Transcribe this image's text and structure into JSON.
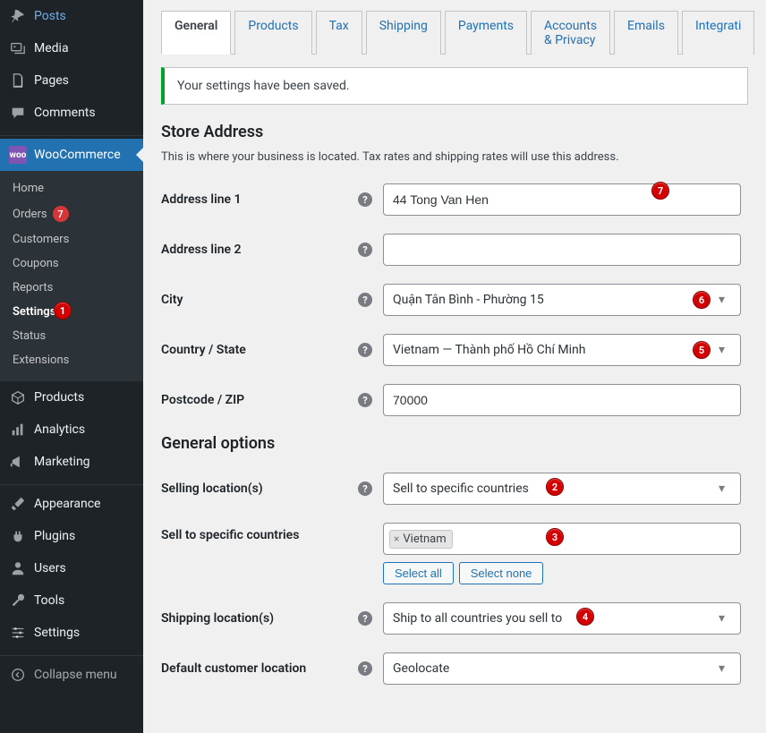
{
  "sidebar": {
    "items_top": [
      {
        "label": "Posts"
      },
      {
        "label": "Media"
      },
      {
        "label": "Pages"
      },
      {
        "label": "Comments"
      }
    ],
    "woo": {
      "label": "WooCommerce"
    },
    "submenu": [
      {
        "label": "Home"
      },
      {
        "label": "Orders",
        "badge": "7"
      },
      {
        "label": "Customers"
      },
      {
        "label": "Coupons"
      },
      {
        "label": "Reports"
      },
      {
        "label": "Settings"
      },
      {
        "label": "Status"
      },
      {
        "label": "Extensions"
      }
    ],
    "items_mid": [
      {
        "label": "Products"
      },
      {
        "label": "Analytics"
      },
      {
        "label": "Marketing"
      }
    ],
    "items_bot": [
      {
        "label": "Appearance"
      },
      {
        "label": "Plugins"
      },
      {
        "label": "Users"
      },
      {
        "label": "Tools"
      },
      {
        "label": "Settings"
      }
    ],
    "collapse": "Collapse menu"
  },
  "tabs": [
    {
      "label": "General"
    },
    {
      "label": "Products"
    },
    {
      "label": "Tax"
    },
    {
      "label": "Shipping"
    },
    {
      "label": "Payments"
    },
    {
      "label": "Accounts & Privacy"
    },
    {
      "label": "Emails"
    },
    {
      "label": "Integrati"
    }
  ],
  "notice": "Your settings have been saved.",
  "section1": {
    "title": "Store Address",
    "desc": "This is where your business is located. Tax rates and shipping rates will use this address.",
    "addr1_label": "Address line 1",
    "addr1_value": "44 Tong Van Hen",
    "addr2_label": "Address line 2",
    "addr2_value": "",
    "city_label": "City",
    "city_value": "Quận Tân Bình - Phường 15",
    "country_label": "Country / State",
    "country_value": "Vietnam — Thành phố Hồ Chí Minh",
    "postcode_label": "Postcode / ZIP",
    "postcode_value": "70000"
  },
  "section2": {
    "title": "General options",
    "selling_label": "Selling location(s)",
    "selling_value": "Sell to specific countries",
    "sellto_label": "Sell to specific countries",
    "sellto_token": "Vietnam",
    "select_all": "Select all",
    "select_none": "Select none",
    "shipping_label": "Shipping location(s)",
    "shipping_value": "Ship to all countries you sell to",
    "default_loc_label": "Default customer location",
    "default_loc_value": "Geolocate"
  }
}
